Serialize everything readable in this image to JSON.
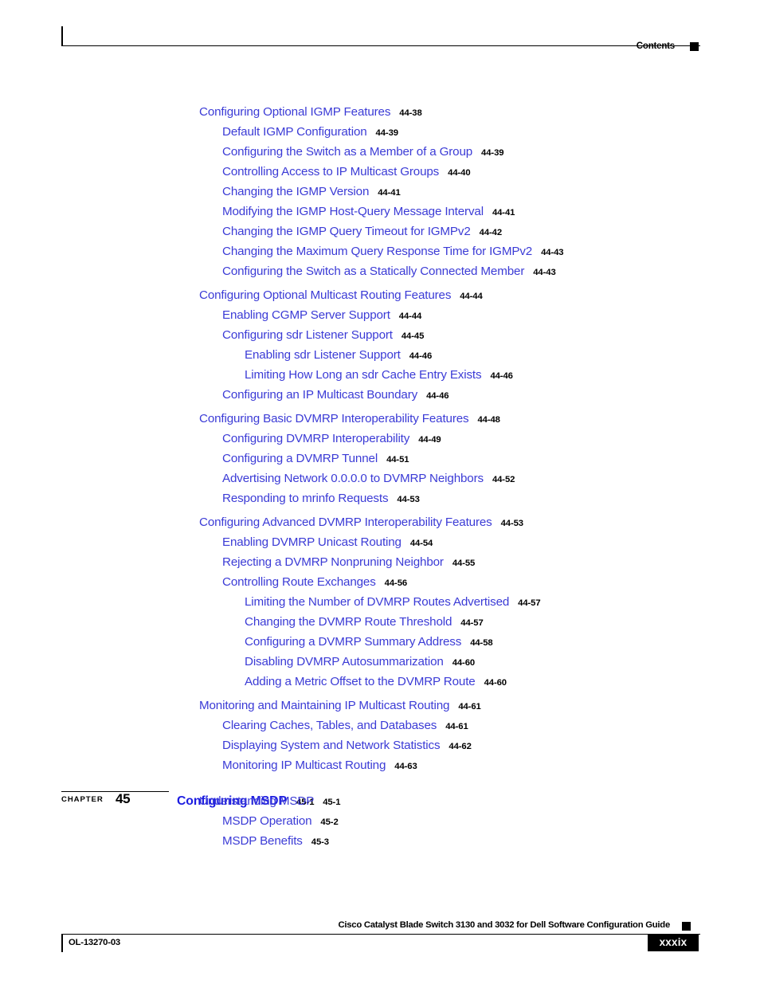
{
  "header": {
    "label": "Contents"
  },
  "toc": {
    "entries": [
      {
        "title": "Configuring Optional IGMP Features",
        "page": "44-38",
        "level": 1
      },
      {
        "title": "Default IGMP Configuration",
        "page": "44-39",
        "level": 2
      },
      {
        "title": "Configuring the Switch as a Member of a Group",
        "page": "44-39",
        "level": 2
      },
      {
        "title": "Controlling Access to IP Multicast Groups",
        "page": "44-40",
        "level": 2
      },
      {
        "title": "Changing the IGMP Version",
        "page": "44-41",
        "level": 2
      },
      {
        "title": "Modifying the IGMP Host-Query Message Interval",
        "page": "44-41",
        "level": 2
      },
      {
        "title": "Changing the IGMP Query Timeout for IGMPv2",
        "page": "44-42",
        "level": 2
      },
      {
        "title": "Changing the Maximum Query Response Time for IGMPv2",
        "page": "44-43",
        "level": 2
      },
      {
        "title": "Configuring the Switch as a Statically Connected Member",
        "page": "44-43",
        "level": 2
      },
      {
        "title": "Configuring Optional Multicast Routing Features",
        "page": "44-44",
        "level": 1
      },
      {
        "title": "Enabling CGMP Server Support",
        "page": "44-44",
        "level": 2
      },
      {
        "title": "Configuring sdr Listener Support",
        "page": "44-45",
        "level": 2
      },
      {
        "title": "Enabling sdr Listener Support",
        "page": "44-46",
        "level": 3
      },
      {
        "title": "Limiting How Long an sdr Cache Entry Exists",
        "page": "44-46",
        "level": 3
      },
      {
        "title": "Configuring an IP Multicast Boundary",
        "page": "44-46",
        "level": 2
      },
      {
        "title": "Configuring Basic DVMRP Interoperability Features",
        "page": "44-48",
        "level": 1
      },
      {
        "title": "Configuring DVMRP Interoperability",
        "page": "44-49",
        "level": 2
      },
      {
        "title": "Configuring a DVMRP Tunnel",
        "page": "44-51",
        "level": 2
      },
      {
        "title": "Advertising Network 0.0.0.0 to DVMRP Neighbors",
        "page": "44-52",
        "level": 2
      },
      {
        "title": "Responding to mrinfo Requests",
        "page": "44-53",
        "level": 2
      },
      {
        "title": "Configuring Advanced DVMRP Interoperability Features",
        "page": "44-53",
        "level": 1
      },
      {
        "title": "Enabling DVMRP Unicast Routing",
        "page": "44-54",
        "level": 2
      },
      {
        "title": "Rejecting a DVMRP Nonpruning Neighbor",
        "page": "44-55",
        "level": 2
      },
      {
        "title": "Controlling Route Exchanges",
        "page": "44-56",
        "level": 2
      },
      {
        "title": "Limiting the Number of DVMRP Routes Advertised",
        "page": "44-57",
        "level": 3
      },
      {
        "title": "Changing the DVMRP Route Threshold",
        "page": "44-57",
        "level": 3
      },
      {
        "title": "Configuring a DVMRP Summary Address",
        "page": "44-58",
        "level": 3
      },
      {
        "title": "Disabling DVMRP Autosummarization",
        "page": "44-60",
        "level": 3
      },
      {
        "title": "Adding a Metric Offset to the DVMRP Route",
        "page": "44-60",
        "level": 3
      },
      {
        "title": "Monitoring and Maintaining IP Multicast Routing",
        "page": "44-61",
        "level": 1
      },
      {
        "title": "Clearing Caches, Tables, and Databases",
        "page": "44-61",
        "level": 2
      },
      {
        "title": "Displaying System and Network Statistics",
        "page": "44-62",
        "level": 2
      },
      {
        "title": "Monitoring IP Multicast Routing",
        "page": "44-63",
        "level": 2
      }
    ]
  },
  "chapter": {
    "word": "Chapter",
    "number": "45",
    "title": "Configuring MSDP",
    "page": "45-1",
    "entries": [
      {
        "title": "Understanding MSDP",
        "page": "45-1",
        "level": 1
      },
      {
        "title": "MSDP Operation",
        "page": "45-2",
        "level": 2
      },
      {
        "title": "MSDP Benefits",
        "page": "45-3",
        "level": 2
      }
    ]
  },
  "footer": {
    "doc_title": "Cisco Catalyst Blade Switch 3130 and 3032 for Dell Software Configuration Guide",
    "doc_id": "OL-13270-03",
    "page_number": "xxxix"
  }
}
